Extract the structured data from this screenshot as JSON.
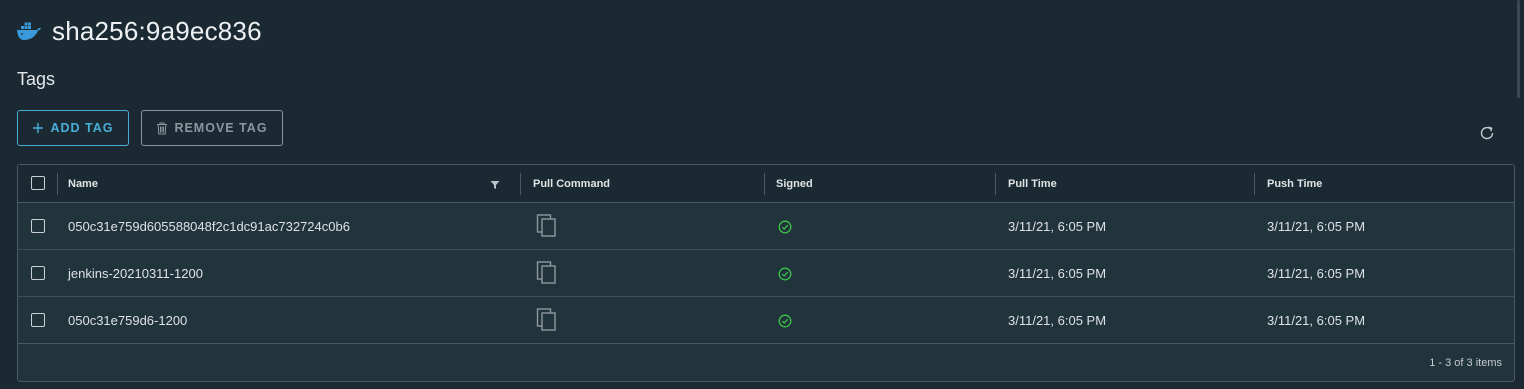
{
  "page": {
    "title": "sha256:9a9ec836",
    "subtitle": "Tags"
  },
  "toolbar": {
    "add_label": "ADD TAG",
    "remove_label": "REMOVE TAG"
  },
  "table": {
    "columns": [
      "Name",
      "Pull Command",
      "Signed",
      "Pull Time",
      "Push Time"
    ],
    "rows": [
      {
        "name": "050c31e759d605588048f2c1dc91ac732724c0b6",
        "pull_time": "3/11/21, 6:05 PM",
        "push_time": "3/11/21, 6:05 PM"
      },
      {
        "name": "jenkins-20210311-1200",
        "pull_time": "3/11/21, 6:05 PM",
        "push_time": "3/11/21, 6:05 PM"
      },
      {
        "name": "050c31e759d6-1200",
        "pull_time": "3/11/21, 6:05 PM",
        "push_time": "3/11/21, 6:05 PM"
      }
    ],
    "footer": "1 - 3 of 3 items"
  },
  "icons": {
    "logo": "docker-whale-icon",
    "add": "plus-icon",
    "remove": "trash-icon",
    "refresh": "refresh-icon",
    "filter": "filter-icon",
    "pull_command": "copy-icon",
    "signed": "check-circle-icon"
  },
  "colors": {
    "background": "#1b2a32",
    "accent": "#49afd9",
    "success": "#3cc34a",
    "muted": "#8a979e"
  }
}
